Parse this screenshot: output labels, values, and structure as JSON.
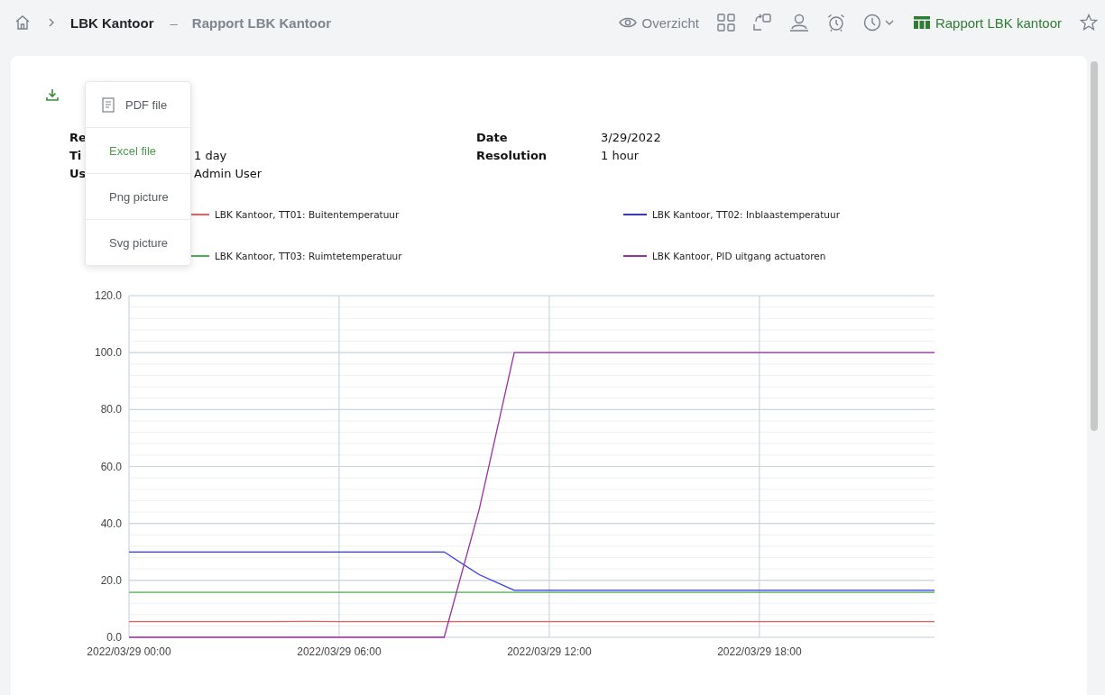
{
  "breadcrumb": {
    "parent": "LBK Kantoor",
    "separator": "–",
    "current": "Rapport LBK Kantoor"
  },
  "toolbar": {
    "overview": "Overzicht",
    "report_link": "Rapport LBK kantoor"
  },
  "export_menu": [
    {
      "label": "PDF file",
      "hovered": false,
      "kind": "pdf"
    },
    {
      "label": "Excel file",
      "hovered": true,
      "kind": "plain"
    },
    {
      "label": "Png picture",
      "hovered": false,
      "kind": "plain"
    },
    {
      "label": "Svg picture",
      "hovered": false,
      "kind": "plain"
    }
  ],
  "info_left": [
    {
      "label": "Re"
    },
    {
      "label": "Ti",
      "value": "1 day"
    },
    {
      "label": "Us",
      "value": "Admin  User"
    }
  ],
  "info_right": [
    {
      "label": "Date",
      "value": "3/29/2022"
    },
    {
      "label": "Resolution",
      "value": "1 hour"
    }
  ],
  "chart_data": {
    "type": "line",
    "grid": true,
    "categories": [
      "2022/03/29 00:00",
      null,
      null,
      null,
      null,
      null,
      "2022/03/29 06:00",
      null,
      null,
      null,
      null,
      null,
      "2022/03/29 12:00",
      null,
      null,
      null,
      null,
      null,
      "2022/03/29 18:00",
      null,
      null,
      null,
      null,
      null
    ],
    "ylim": [
      0,
      120
    ],
    "yticks": [
      {
        "value": 0,
        "label": "0.0"
      },
      {
        "value": 20,
        "label": "20.0"
      },
      {
        "value": 40,
        "label": "40.0"
      },
      {
        "value": 60,
        "label": "60.0"
      },
      {
        "value": 80,
        "label": "80.0"
      },
      {
        "value": 100,
        "label": "100.0"
      },
      {
        "value": 120,
        "label": "120.0"
      }
    ],
    "series": [
      {
        "name": "LBK Kantoor, TT01: Buitentemperatuur",
        "color": "#f05a5a",
        "values": [
          5.5,
          5.5,
          5.5,
          5.5,
          5.5,
          5.6,
          5.5,
          5.5,
          5.5,
          5.5,
          5.5,
          5.5,
          5.5,
          5.5,
          5.5,
          5.5,
          5.5,
          5.5,
          5.5,
          5.5,
          5.5,
          5.5,
          5.5,
          5.5
        ]
      },
      {
        "name": "LBK Kantoor, TT02: Inblaastemperatuur",
        "color": "#3232f0",
        "values": [
          30,
          30,
          30,
          30,
          30,
          30,
          30,
          30,
          30,
          30,
          22,
          16.5,
          16.5,
          16.5,
          16.5,
          16.5,
          16.5,
          16.5,
          16.5,
          16.5,
          16.5,
          16.5,
          16.5,
          16.5
        ]
      },
      {
        "name": "LBK Kantoor, TT03: Ruimtetemperatuur",
        "color": "#4caf50",
        "values": [
          15.8,
          15.8,
          15.8,
          15.8,
          15.8,
          15.8,
          15.8,
          15.8,
          15.8,
          15.8,
          15.8,
          15.8,
          15.8,
          15.8,
          15.8,
          15.8,
          15.8,
          15.8,
          15.8,
          15.8,
          15.8,
          15.8,
          15.8,
          15.8
        ]
      },
      {
        "name": "LBK Kantoor, PID uitgang actuatoren",
        "color": "#9b2fa0",
        "values": [
          0,
          0,
          0,
          0,
          0,
          0,
          0,
          0,
          0,
          0,
          45,
          100,
          100,
          100,
          100,
          100,
          100,
          100,
          100,
          100,
          100,
          100,
          100,
          100
        ]
      }
    ]
  }
}
